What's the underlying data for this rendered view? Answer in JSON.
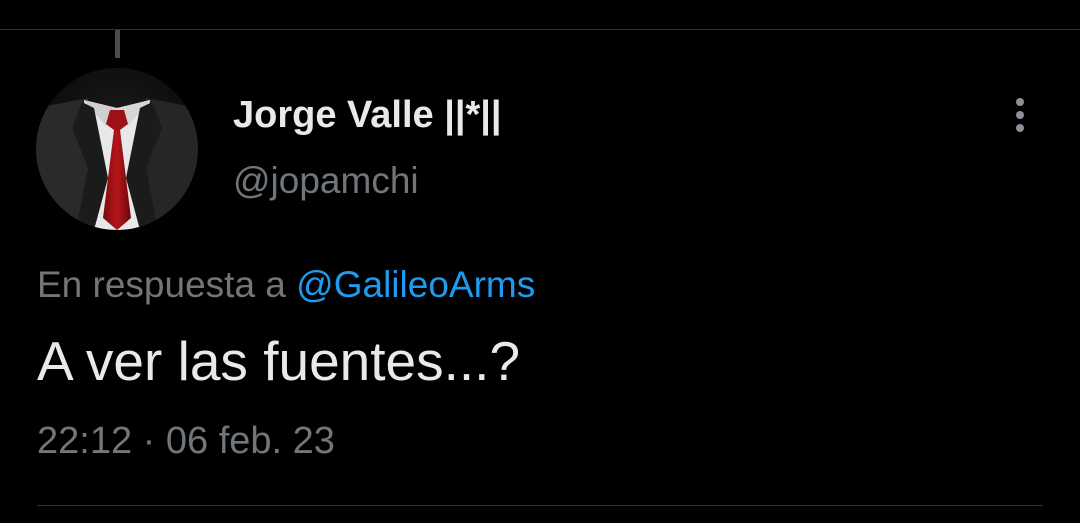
{
  "tweet": {
    "author": {
      "display_name": "Jorge Valle ||*||",
      "handle": "@jopamchi"
    },
    "reply": {
      "prefix": "En respuesta a ",
      "mention": "@GalileoArms"
    },
    "text": "A ver las fuentes...?",
    "timestamp": "22:12 · 06 feb. 23"
  },
  "icons": {
    "more": "more-vertical-icon"
  },
  "colors": {
    "background": "#000000",
    "text_primary": "#e7e9ea",
    "text_secondary": "#71767b",
    "link": "#1d9bf0",
    "divider": "#2f3336"
  }
}
